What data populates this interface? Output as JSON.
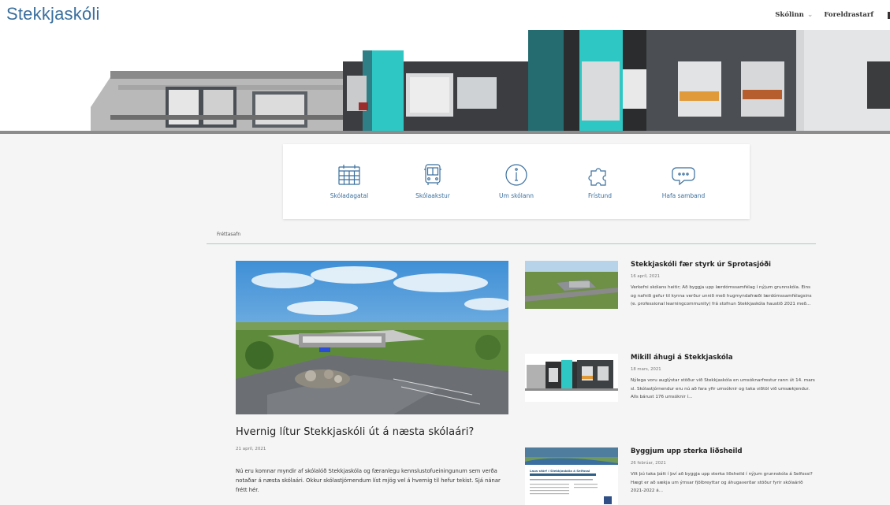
{
  "site": {
    "title": "Stekkjaskóli"
  },
  "nav": [
    {
      "label": "Skólinn",
      "has_dropdown": true
    },
    {
      "label": "Foreldrastarf",
      "has_dropdown": false
    }
  ],
  "quick_links": [
    {
      "label": "Skóladagatal",
      "icon": "calendar-icon"
    },
    {
      "label": "Skólaakstur",
      "icon": "bus-icon"
    },
    {
      "label": "Um skólann",
      "icon": "info-icon"
    },
    {
      "label": "Frístund",
      "icon": "puzzle-icon"
    },
    {
      "label": "Hafa samband",
      "icon": "chat-bubble-icon"
    }
  ],
  "section": {
    "label": "Fréttasafn"
  },
  "featured": {
    "title": "Hvernig lítur Stekkjaskóli út á næsta skólaári?",
    "date": "21 apríl, 2021",
    "body": "Nú eru komnar myndir af skólalóð Stekkjaskóla og færanlegu kennslustofueiningunum sem verða notaðar á næsta skólaári. Okkur skólastjórnendum líst mjög vel á hvernig til hefur tekist. Sjá nánar frétt hér."
  },
  "news": [
    {
      "title": "Stekkjaskóli fær styrk úr Sprotasjóði",
      "date": "16 apríl, 2021",
      "excerpt": "Verkefni skólans heitir; Að byggja upp lærdómssamfélag í nýjum grunnskóla. Eins og nafnið gefur til kynna verður unnið með hugmyndafræði lærdómssamfélagsins (e. professional learningcommunity) frá stofnun Stekkjaskóla haustið 2021 með..."
    },
    {
      "title": "Mikill áhugi á Stekkjaskóla",
      "date": "18 mars, 2021",
      "excerpt": "Nýlega voru auglýstar stöður við Stekkjaskóla en umsóknarfrestur rann út 14. mars sl. Skólastjórnendur eru nú að fara yfir umsóknir og taka viðtöl við umsækjendur. Alls bárust 176 umsóknir í..."
    },
    {
      "title": "Byggjum upp sterka liðsheild",
      "date": "26 febrúar, 2021",
      "excerpt": "Vilt þú taka þátt í því að byggja upp sterka liðsheild í nýjum grunnskóla á Selfossi? Hægt er að sækja um ýmsar fjölbreyttar og áhugaverðar stöður fyrir skólaárið 2021-2022 á...",
      "thumb_text": "Laus störf í Stekkjaskóla á Selfossi"
    }
  ],
  "colors": {
    "brand": "#3a6f9e",
    "accent_line": "#9fd0c4",
    "teal_panel": "#2fc7c4"
  }
}
